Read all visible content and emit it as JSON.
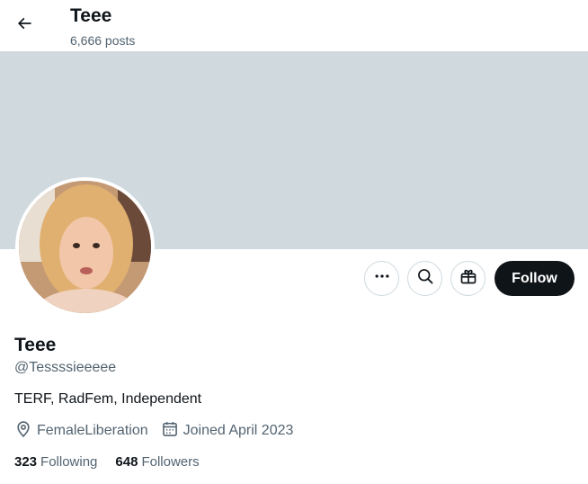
{
  "header": {
    "title": "Teee",
    "post_count": "6,666 posts",
    "back_icon": "arrow-left-icon"
  },
  "banner": {
    "color": "#cfd9de"
  },
  "actions": {
    "more_icon": "more-horizontal-icon",
    "search_icon": "search-icon",
    "gift_icon": "gift-icon",
    "follow_label": "Follow"
  },
  "profile": {
    "name": "Teee",
    "handle": "@Tessssieeeee",
    "bio": "TERF, RadFem, Independent",
    "location": "FemaleLiberation",
    "joined": "Joined April 2023",
    "following_count": "323",
    "following_label": "Following",
    "followers_count": "648",
    "followers_label": "Followers"
  },
  "colors": {
    "text_primary": "#0f1419",
    "text_secondary": "#536471",
    "button_dark": "#0f1419",
    "border": "#cfd9de"
  }
}
